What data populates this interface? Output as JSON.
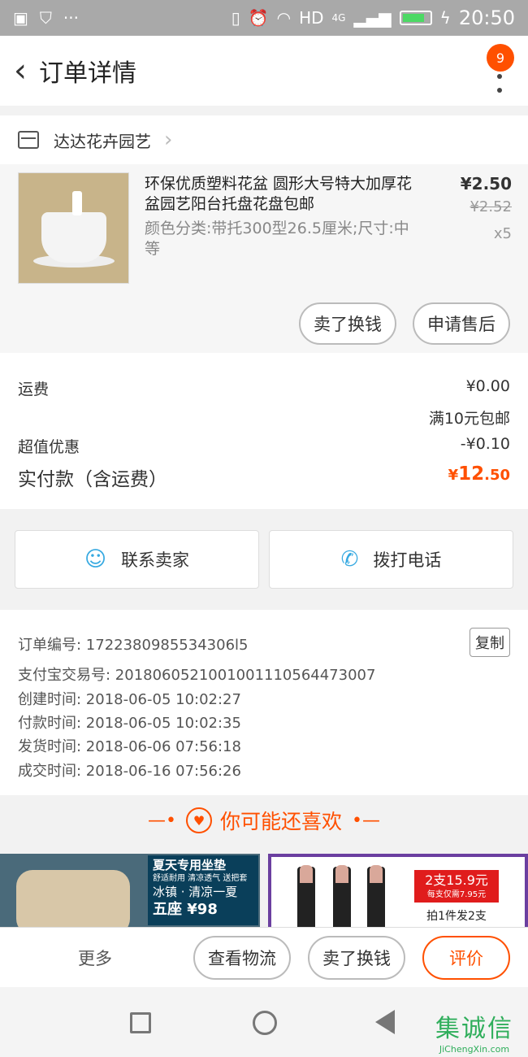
{
  "status_bar": {
    "time": "20:50",
    "network": "HD",
    "network_type": "4G",
    "icons": [
      "image-icon",
      "shield-icon",
      "more-icon",
      "vibrate-icon",
      "alarm-icon",
      "wifi-icon",
      "signal-icon",
      "battery-icon",
      "charging-icon"
    ],
    "battery_level": 0.8
  },
  "header": {
    "back_glyph": "‹",
    "title": "订单详情",
    "badge_count": "9"
  },
  "shop": {
    "name": "达达花卉园艺",
    "arrow": "›"
  },
  "product": {
    "name": "环保优质塑料花盆 圆形大号特大加厚花盆园艺阳台托盘花盘包邮",
    "sku": "颜色分类:带托300型26.5厘米;尺寸:中等",
    "price": "¥2.50",
    "original_price": "¥2.52",
    "quantity": "x5",
    "buttons": {
      "sell": "卖了换钱",
      "after_sale": "申请售后"
    }
  },
  "fees": {
    "shipping_label": "运费",
    "shipping_value": "¥0.00",
    "shipping_note": "满10元包邮",
    "discount_label": "超值优惠",
    "discount_value": "-¥0.10",
    "total_label": "实付款（含运费）",
    "total_currency": "¥",
    "total_int": "12",
    "total_dec": ".50"
  },
  "contact": {
    "seller": "联系卖家",
    "call": "拨打电话"
  },
  "order_info": {
    "order_no": "订单编号: 1722380985534306l5",
    "alipay_no": "支付宝交易号: 2018060521001001110564473007",
    "created": "创建时间: 2018-06-05 10:02:27",
    "paid": "付款时间: 2018-06-05 10:02:35",
    "shipped": "发货时间: 2018-06-06 07:56:18",
    "completed": "成交时间: 2018-06-16 07:56:26",
    "copy_label": "复制"
  },
  "recommend": {
    "title": "你可能还喜欢",
    "left_banner_line1": "夏天专用坐垫",
    "left_banner_line2": "舒适耐用 清凉透气 送把套",
    "left_banner_line3": "冰镇 · 清凉一夏",
    "left_banner_line4": "五座 ¥98",
    "right_promo": "2支15.9元",
    "right_promo_sub": "每支仅需7.95元",
    "right_promo2": "拍1件发2支"
  },
  "bottom_bar": {
    "more": "更多",
    "logistics": "查看物流",
    "sell": "卖了换钱",
    "review": "评价"
  },
  "watermark": {
    "main": "集诚信",
    "sub": "JiChengXin.com"
  },
  "colors": {
    "accent": "#ff5000",
    "contact_icon": "#36a9e1",
    "status_bar": "#a9a9a9",
    "watermark": "#2fae5b"
  }
}
